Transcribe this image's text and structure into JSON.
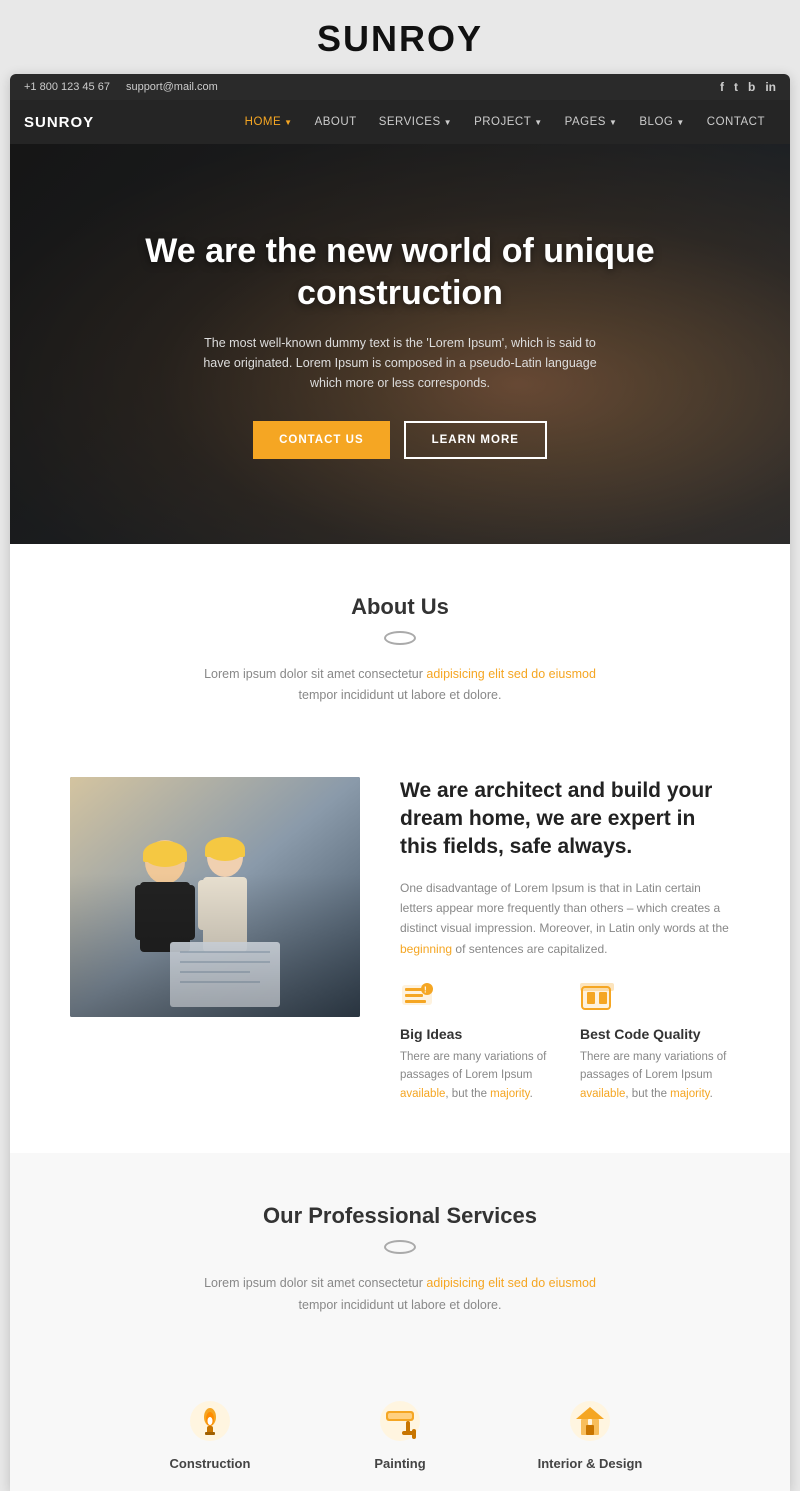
{
  "siteTitle": "SUNROY",
  "topBar": {
    "phone": "+1 800 123 45 67",
    "email": "support@mail.com",
    "socialLinks": [
      "f",
      "t",
      "b",
      "in"
    ]
  },
  "navbar": {
    "brand": "SUNROY",
    "links": [
      {
        "label": "HOME",
        "active": true,
        "hasDropdown": true
      },
      {
        "label": "ABOUT",
        "active": false,
        "hasDropdown": false
      },
      {
        "label": "SERVICES",
        "active": false,
        "hasDropdown": true
      },
      {
        "label": "PROJECT",
        "active": false,
        "hasDropdown": true
      },
      {
        "label": "PAGES",
        "active": false,
        "hasDropdown": true
      },
      {
        "label": "BLOG",
        "active": false,
        "hasDropdown": true
      },
      {
        "label": "CONTACT",
        "active": false,
        "hasDropdown": false
      }
    ]
  },
  "hero": {
    "title": "We are the new world of unique construction",
    "subtitle": "The most well-known dummy text is the 'Lorem Ipsum', which is said to have originated. Lorem Ipsum is composed in a pseudo-Latin language which more or less corresponds.",
    "ctaButton": "CONTACT US",
    "secondaryButton": "LEARN MORE"
  },
  "about": {
    "sectionTitle": "About",
    "sectionTitleBold": "Us",
    "description": "Lorem ipsum dolor sit amet consectetur adipisicing elit sed do eiusmod tempor incididunt ut labore et dolore.",
    "heading": "We are architect and build your dream home, we are expert in this fields, safe always.",
    "paragraph": "One disadvantage of Lorem Ipsum is that in Latin certain letters appear more frequently than others – which creates a distinct visual impression. Moreover, in Latin only words at the beginning of sentences are capitalized.",
    "features": [
      {
        "title": "Big Ideas",
        "desc": "There are many variations of passages of Lorem Ipsum available, but the majority.",
        "icon": "lightbulb"
      },
      {
        "title": "Best Code Quality",
        "desc": "There are many variations of passages of Lorem Ipsum available, but the majority.",
        "icon": "folder"
      }
    ]
  },
  "services": {
    "sectionTitle": "Our Professional",
    "sectionTitleBold": "Services",
    "description": "Lorem ipsum dolor sit amet consectetur adipisicing elit sed do eiusmod tempor incididunt ut labore et dolore.",
    "items": [
      {
        "name": "Construction",
        "icon": "hammer"
      },
      {
        "name": "Painting",
        "icon": "paint"
      },
      {
        "name": "Interior & Design",
        "icon": "design"
      }
    ]
  }
}
